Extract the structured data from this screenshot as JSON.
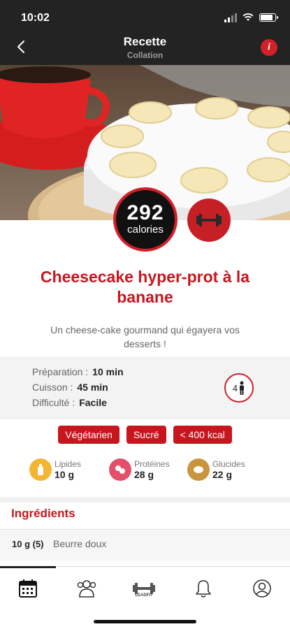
{
  "status": {
    "time": "10:02"
  },
  "header": {
    "title": "Recette",
    "subtitle": "Collation",
    "info_label": "i"
  },
  "recipe": {
    "calories_value": "292",
    "calories_unit": "calories",
    "title": "Cheesecake hyper-prot à la banane",
    "description": "Un cheese-cake gourmand qui égayera vos desserts !"
  },
  "details": {
    "prep_label": "Préparation :",
    "prep_value": "10 min",
    "cook_label": "Cuisson :",
    "cook_value": "45 min",
    "diff_label": "Difficulté :",
    "diff_value": "Facile",
    "servings": "4"
  },
  "tags": [
    "Végétarien",
    "Sucré",
    "< 400 kcal"
  ],
  "macros": [
    {
      "label": "Lipides",
      "value": "10 g",
      "color": "#f2b632"
    },
    {
      "label": "Protéines",
      "value": "28 g",
      "color": "#e2506b"
    },
    {
      "label": "Glucides",
      "value": "22 g",
      "color": "#c9953f"
    }
  ],
  "ingredients": {
    "heading": "Ingrédients",
    "items": [
      {
        "qty": "10 g (5)",
        "name": "Beurre doux"
      }
    ]
  },
  "nav": {
    "logo_text": "LEADFIT"
  },
  "colors": {
    "accent": "#c8161e",
    "header_bg": "#232323"
  }
}
